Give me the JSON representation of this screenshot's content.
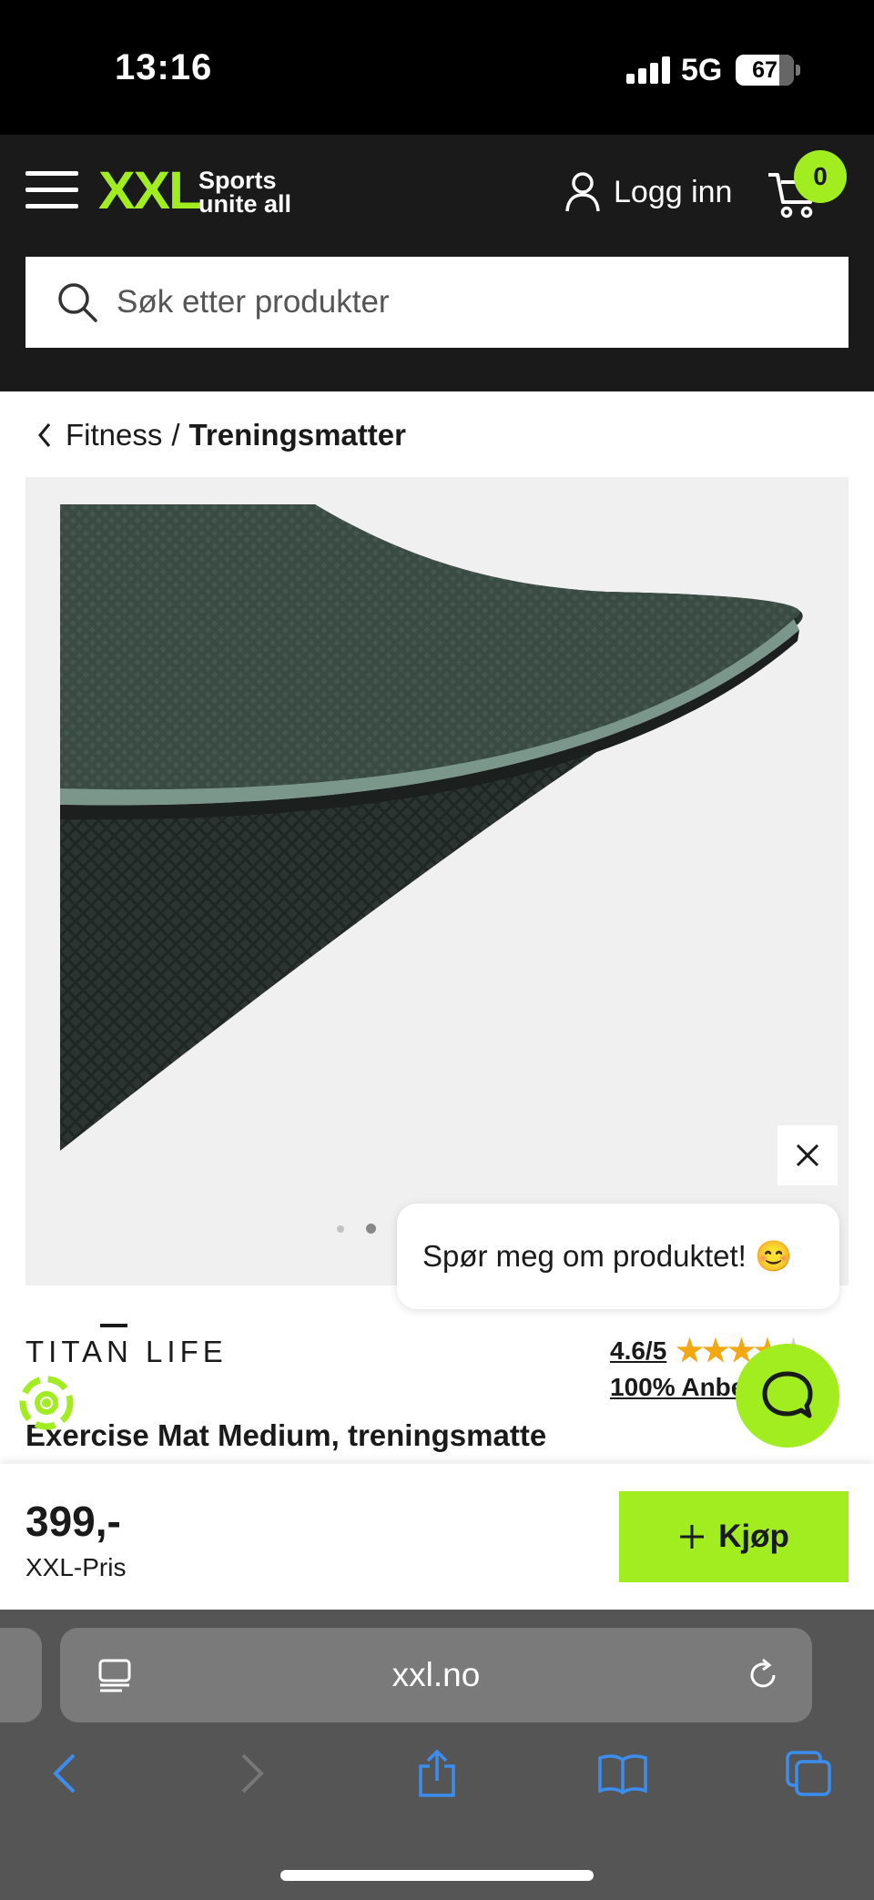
{
  "status_bar": {
    "time": "13:16",
    "network": "5G",
    "battery": "67"
  },
  "header": {
    "logo_text": "XXL",
    "logo_tagline_1": "Sports",
    "logo_tagline_2": "unite all",
    "login_label": "Logg inn",
    "cart_count": "0",
    "accent_color": "#a1ed1f"
  },
  "search": {
    "placeholder": "Søk etter produkter"
  },
  "breadcrumb": {
    "parent": "Fitness",
    "separator": "/",
    "current": "Treningsmatter"
  },
  "gallery": {
    "slide_count": 2,
    "active_slide": 2
  },
  "chat": {
    "bubble_text": "Spør meg om produktet! 😊"
  },
  "product": {
    "brand_logo_text": "TITAN LIFE",
    "rating_score": "4.6/5",
    "rating_value": 4.6,
    "rating_max": 5,
    "recommend_text": "100% Anbefaler",
    "title": "Exercise Mat Medium, treningsmatte"
  },
  "buy_bar": {
    "price": "399,-",
    "price_label": "XXL-Pris",
    "buy_label": "Kjøp"
  },
  "browser": {
    "url": "xxl.no"
  }
}
